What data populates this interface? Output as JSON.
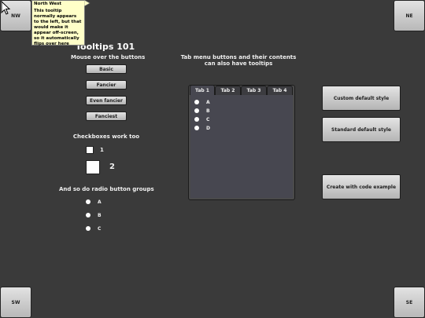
{
  "corners": {
    "nw": "NW",
    "ne": "NE",
    "sw": "SW",
    "se": "SE"
  },
  "tooltip": {
    "title": "North West",
    "body": "This tooltip normally appears to the left, but that would make it appear off-screen, so it automatically flips over here"
  },
  "left": {
    "title": "Tooltips 101",
    "mouse_over_label": "Mouse over the buttons",
    "buttons": [
      "Basic",
      "Fancier",
      "Even fancier",
      "Fanciest"
    ],
    "checkbox_label": "Checkboxes work too",
    "checkboxes": [
      "1",
      "2"
    ],
    "radio_label": "And so do radio button groups",
    "radios": [
      "A",
      "B",
      "C"
    ]
  },
  "tabs": {
    "caption_line1": "Tab menu buttons and their contents",
    "caption_line2": "can also have tooltips",
    "items": [
      "Tab 1",
      "Tab 2",
      "Tab 3",
      "Tab 4"
    ],
    "active_index": 0,
    "options": [
      "A",
      "B",
      "C",
      "D"
    ]
  },
  "right": {
    "buttons": [
      "Custom default style",
      "Standard default style",
      "Create with code example"
    ]
  }
}
